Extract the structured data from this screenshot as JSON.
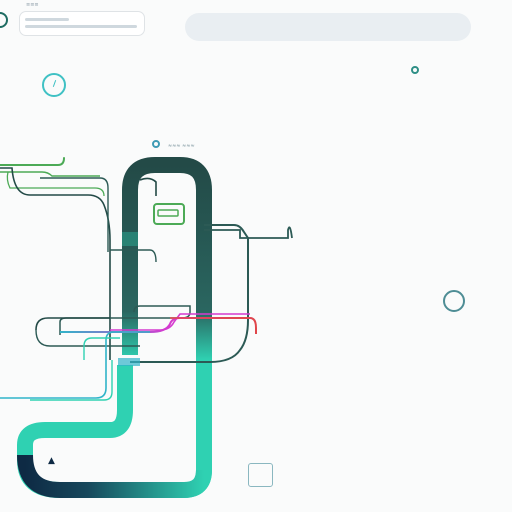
{
  "window": {
    "tag_text": "≡≡≡"
  },
  "route": {
    "label_text": "≈≈≈ ≈≈≈"
  },
  "icons": {
    "top_left": "ring-icon",
    "clock": "clock-icon",
    "pin": "location-pin-icon",
    "right": "ring-icon",
    "square": "square-button-icon",
    "warning": "triangle-icon",
    "folder": "folder-icon"
  },
  "colors": {
    "dark_pipe": "#234a47",
    "navy_pipe": "#0e2a44",
    "teal_pipe": "#2fd1b2",
    "green_wire": "#4caa56",
    "magenta_wire": "#d43bd0",
    "red_wire": "#e0464a",
    "cyan_wire": "#30b4c9",
    "search_bg": "#e9eef2"
  },
  "glyphs": {
    "warning": "▲"
  }
}
